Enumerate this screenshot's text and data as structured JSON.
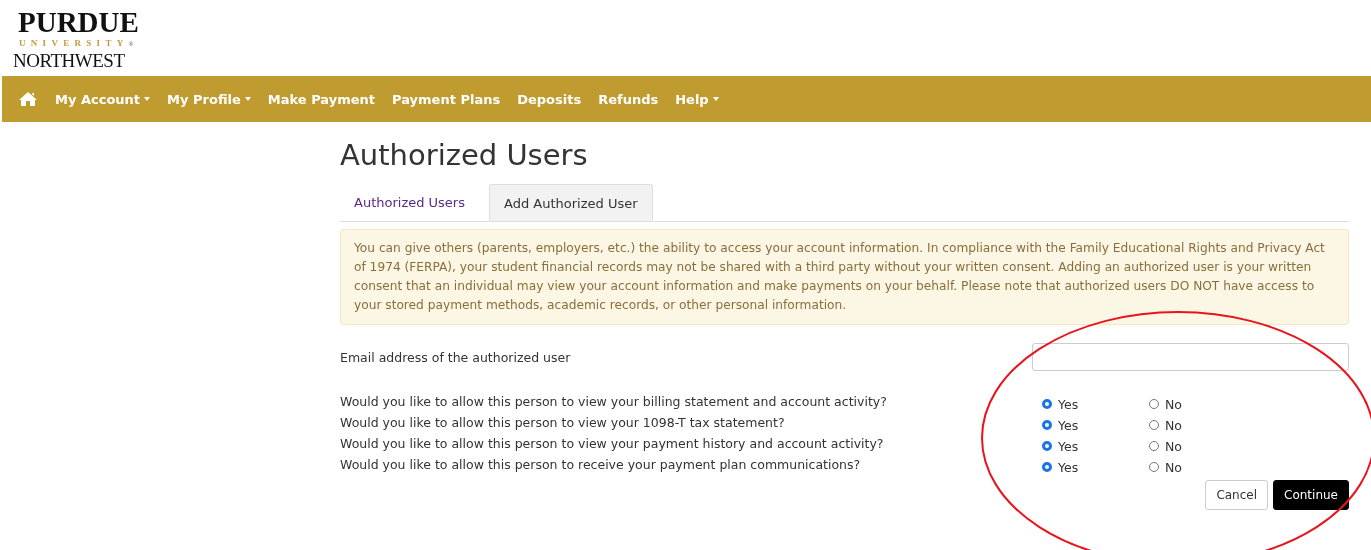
{
  "logo": {
    "line_1": "PURDUE",
    "line_2": "UNIVERSITY",
    "mark": "®",
    "line_3": "NORTHWEST"
  },
  "nav": [
    {
      "label": "My Account",
      "dropdown": true
    },
    {
      "label": "My Profile",
      "dropdown": true
    },
    {
      "label": "Make Payment",
      "dropdown": false
    },
    {
      "label": "Payment Plans",
      "dropdown": false
    },
    {
      "label": "Deposits",
      "dropdown": false
    },
    {
      "label": "Refunds",
      "dropdown": false
    },
    {
      "label": "Help",
      "dropdown": true
    }
  ],
  "page_title": "Authorized Users",
  "tabs": [
    {
      "label": "Authorized Users",
      "selected": false
    },
    {
      "label": "Add Authorized User",
      "selected": true
    }
  ],
  "notice": "You can give others (parents, employers, etc.) the ability to access your account information. In compliance with the Family Educational Rights and Privacy Act of 1974 (FERPA), your student financial records may not be shared with a third party without your written consent. Adding an authorized user is your written consent that an individual may view your account information and make payments on your behalf. Please note that authorized users DO NOT have access to your stored payment methods, academic records, or other personal information.",
  "email": {
    "label": "Email address of the authorized user"
  },
  "questions": [
    {
      "text": "Would you like to allow this person to view your billing statement and account activity?",
      "options": [
        {
          "label": "Yes",
          "selected": true
        },
        {
          "label": "No",
          "selected": false
        }
      ]
    },
    {
      "text": "Would you like to allow this person to view your 1098-T tax statement?",
      "options": [
        {
          "label": "Yes",
          "selected": true
        },
        {
          "label": "No",
          "selected": false
        }
      ]
    },
    {
      "text": "Would you like to allow this person to view your payment history and account activity?",
      "options": [
        {
          "label": "Yes",
          "selected": true
        },
        {
          "label": "No",
          "selected": false
        }
      ]
    },
    {
      "text": "Would you like to allow this person to receive your payment plan communications?",
      "options": [
        {
          "label": "Yes",
          "selected": true
        },
        {
          "label": "No",
          "selected": false
        }
      ]
    }
  ],
  "buttons": [
    {
      "label": "Cancel",
      "kind": "secondary"
    },
    {
      "label": "Continue",
      "kind": "primary"
    }
  ],
  "annotation": {
    "kind": "ellipse"
  }
}
